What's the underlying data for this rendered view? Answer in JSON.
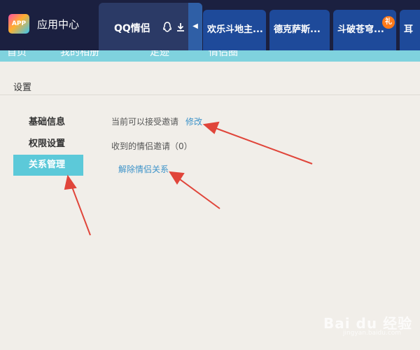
{
  "header": {
    "app_logo_text": "APP",
    "app_title": "应用中心",
    "active_tab": {
      "label": "QQ情侣",
      "icons": [
        "qq-penguin-icon",
        "download-icon"
      ]
    },
    "tabs": [
      {
        "label": "欢乐斗地主..."
      },
      {
        "label": "德克萨斯..."
      },
      {
        "label": "斗破苍穹...",
        "badge": "礼"
      },
      {
        "label": "耳"
      }
    ]
  },
  "nav": {
    "items": [
      "首页",
      "我的相册",
      "足迹",
      "情侣圈"
    ]
  },
  "settings": {
    "title": "设置",
    "menu": [
      {
        "label": "基础信息",
        "active": false
      },
      {
        "label": "权限设置",
        "active": false
      },
      {
        "label": "关系管理",
        "active": true
      }
    ],
    "accept_status": "当前可以接受邀请",
    "modify_link": "修改",
    "received_invites": "收到的情侣邀请（0）",
    "dissolve_link": "解除情侣关系"
  },
  "watermark": {
    "text": "Bai du 经验",
    "sub": "jingyan.baidu.com"
  },
  "colors": {
    "topbar": "#1b2040",
    "active_tab": "#2b3a66",
    "tab": "#1e4a9a",
    "nav": "#7fd2de",
    "menu_active": "#5cc9d9",
    "link": "#3d93c9",
    "annotation_arrow": "#e0453a",
    "background": "#f1eee9"
  }
}
